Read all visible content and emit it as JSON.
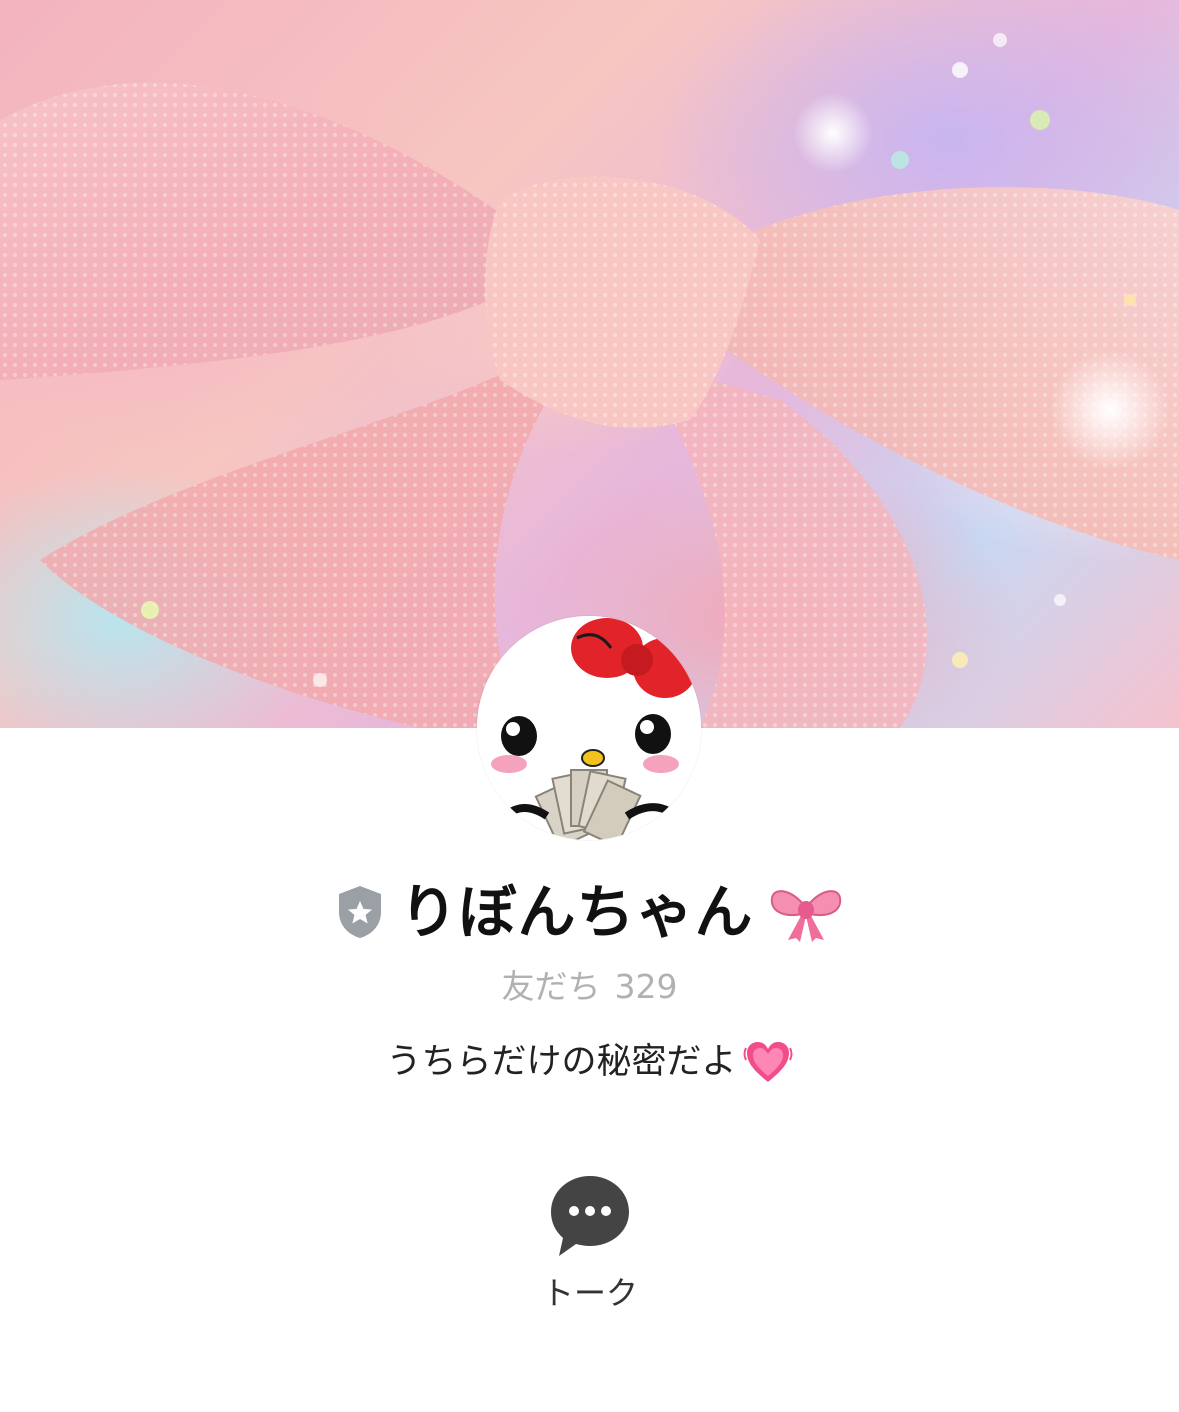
{
  "profile": {
    "name": "りぼんちゃん",
    "friends_label": "友だち",
    "friends_count": "329",
    "status_message": "うちらだけの秘密だよ"
  },
  "cover": {
    "icon": "ribbon-bow-cover-image"
  },
  "avatar": {
    "icon": "kitty-with-money-avatar"
  },
  "badge": {
    "icon": "shield-star-icon",
    "color": "#9aa0a6"
  },
  "emoji": {
    "name_suffix": "ribbon-emoji",
    "status_suffix": "growing-heart-emoji"
  },
  "actions": {
    "talk_label": "トーク",
    "talk_icon": "chat-bubble-icon"
  },
  "colors": {
    "background": "#ffffff",
    "name_text": "#111111",
    "friends_text": "#b1b1b1",
    "status_text": "#222222",
    "talk_icon": "#333333"
  }
}
